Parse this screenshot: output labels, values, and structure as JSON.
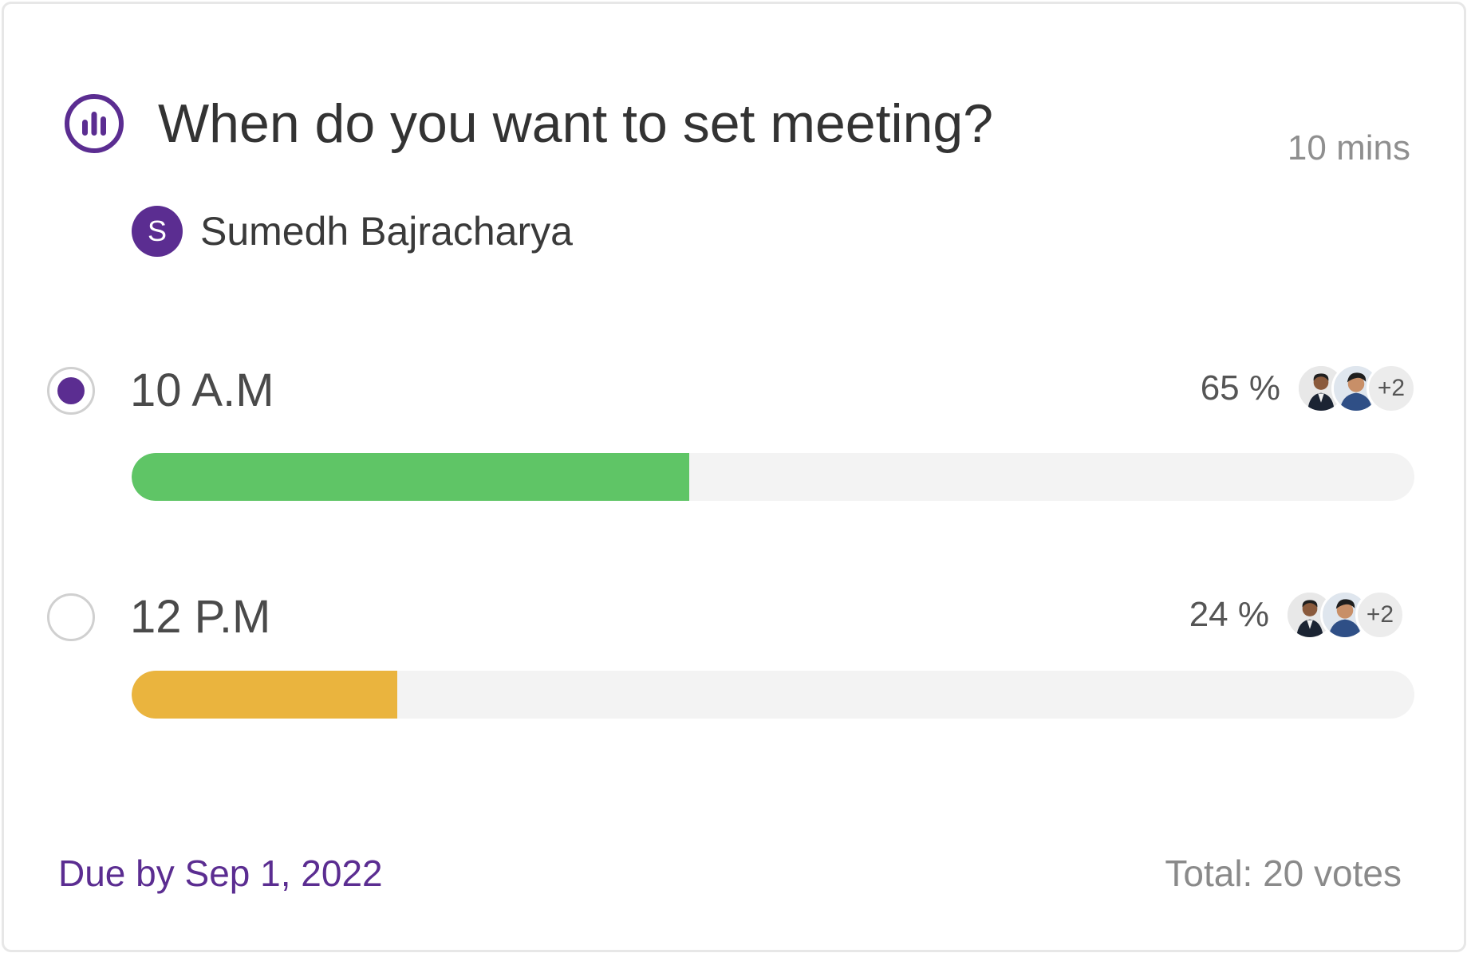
{
  "poll": {
    "question": "When do you want to set meeting?",
    "time_ago": "10 mins",
    "icon": "poll-chart-icon",
    "author": {
      "initial": "S",
      "name": "Sumedh Bajracharya"
    },
    "options": [
      {
        "label": "10 A.M",
        "percent_text": "65 %",
        "fill_fraction": 0.435,
        "selected": true,
        "color": "#5fc566",
        "more_voters": "+2"
      },
      {
        "label": "12 P.M",
        "percent_text": "24 %",
        "fill_fraction": 0.207,
        "selected": false,
        "color": "#eab43e",
        "more_voters": "+2"
      }
    ],
    "due": "Due by Sep 1, 2022",
    "total": "Total: 20 votes"
  },
  "colors": {
    "accent": "#5b2d91",
    "track": "#f3f3f3"
  }
}
